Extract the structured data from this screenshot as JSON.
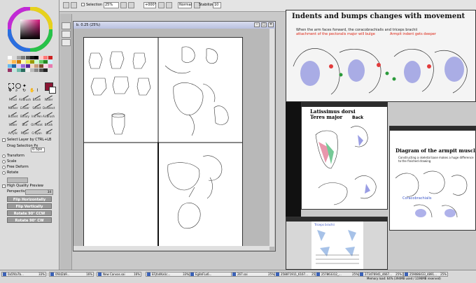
{
  "toolbar": {
    "selection_label": "Selection",
    "zoom_value": "25%",
    "angle_value": "+000°",
    "blend_value": "Normal",
    "stabilizer_label": "Stabilizer",
    "stabilizer_value": "10"
  },
  "tools": {
    "row1": [
      "Marker",
      "Eraser",
      "Select",
      "Deselect"
    ],
    "row2": [
      "Bucket",
      "Binary",
      "Ink Pen",
      "AirBrush"
    ],
    "row3": [
      "Water",
      "Blur",
      "Oil Paint",
      "Brush"
    ],
    "row4": [
      "Acrylic",
      "Paper",
      "Crayon",
      "Blur"
    ],
    "top_row": [
      "Pencil",
      "AirBrush",
      "Brush",
      "Water"
    ]
  },
  "options": {
    "select_layer": "Select Layer by CTRL+LB",
    "drag_selection": "Drag Selection Px",
    "drag_value": "0.5px",
    "transform": "Transform",
    "scale": "Scale",
    "free_deform": "Free Deform",
    "rotate": "Rotate",
    "high_quality": "High Quality Preview",
    "perspective_label": "Perspective",
    "perspective_value": "34"
  },
  "buttons": {
    "flip_h": "Flip Horizontally",
    "flip_v": "Flip Vertically",
    "rotate_ccw": "Rotate 90° CCW",
    "rotate_cw": "Rotate 90° CW"
  },
  "canvas": {
    "title": "b. 0.25 (25%)"
  },
  "refs": {
    "indents_title": "Indents and bumps changes with movement",
    "indents_sub_a": "When the arm faces forward, the coracobrachialis and triceps brachii",
    "indents_sub_b": "attachment of the pectoralis major will bulge",
    "indents_sub_c": "Armpit indent gets deeper",
    "lat_title_a": "Latissimus dorsi",
    "lat_title_b": "Teres major",
    "back_label": "Back",
    "armpit_title": "Diagram of the armpit muscle",
    "armpit_sub": "Constructing a skeletal base makes a huge difference to the finished drawing",
    "coraco_label": "Coracobrachialis",
    "triceps_label": "Triceps brachii"
  },
  "taskbar": {
    "items": [
      {
        "label": "0a5f4a7b...",
        "pct": "33%"
      },
      {
        "label": "0f4d2b9...",
        "pct": "16%"
      },
      {
        "label": "New Canvas.sai",
        "pct": "16%"
      },
      {
        "label": "EFjfo4KxUc...",
        "pct": "33%"
      },
      {
        "label": "Eg8nFLx6...",
        "pct": ""
      },
      {
        "label": "267.sai",
        "pct": "25%"
      },
      {
        "label": "258871911_6167...",
        "pct": "25%"
      },
      {
        "label": "257863312_...",
        "pct": "25%"
      },
      {
        "label": "273476941_4667...",
        "pct": "25%"
      },
      {
        "label": "259086433_4891...",
        "pct": "25%"
      }
    ]
  },
  "status": "Memory load: 64% (394MB used / 1196MB reserved)"
}
